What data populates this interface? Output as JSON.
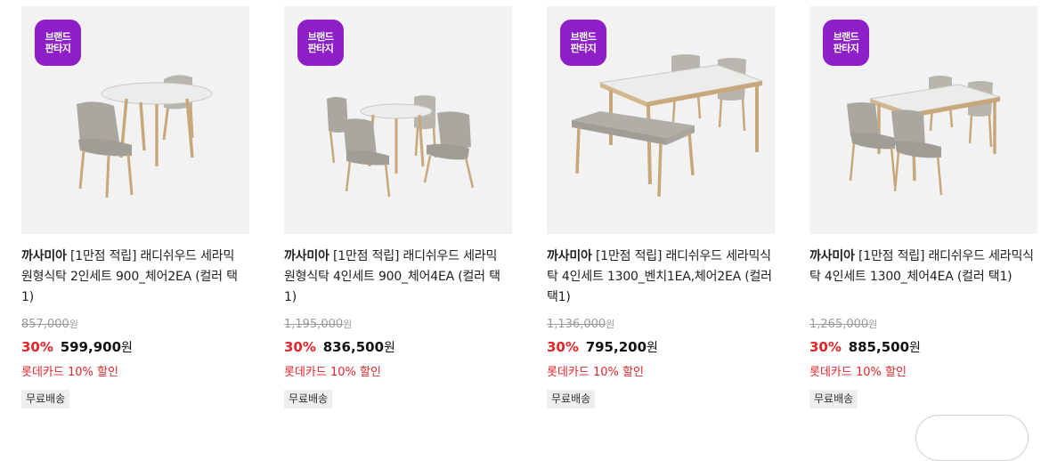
{
  "products": [
    {
      "badge_line1": "브랜드",
      "badge_line2": "판타지",
      "brand": "까사미아",
      "title": "[1만점 적립] 래디쉬우드 세라믹 원형식탁 2인세트 900_체어2EA (컬러 택1)",
      "original_price": "857,000",
      "original_unit": "원",
      "discount_rate": "30%",
      "sale_price": "599,900",
      "sale_unit": "원",
      "card_benefit": "롯데카드 10% 할인",
      "shipping_tag": "무료배송"
    },
    {
      "badge_line1": "브랜드",
      "badge_line2": "판타지",
      "brand": "까사미아",
      "title": "[1만점 적립] 래디쉬우드 세라믹 원형식탁 4인세트 900_체어4EA (컬러 택1)",
      "original_price": "1,195,000",
      "original_unit": "원",
      "discount_rate": "30%",
      "sale_price": "836,500",
      "sale_unit": "원",
      "card_benefit": "롯데카드 10% 할인",
      "shipping_tag": "무료배송"
    },
    {
      "badge_line1": "브랜드",
      "badge_line2": "판타지",
      "brand": "까사미아",
      "title": "[1만점 적립] 래디쉬우드 세라믹식탁 4인세트 1300_벤치1EA,체어2EA (컬러 택1)",
      "original_price": "1,136,000",
      "original_unit": "원",
      "discount_rate": "30%",
      "sale_price": "795,200",
      "sale_unit": "원",
      "card_benefit": "롯데카드 10% 할인",
      "shipping_tag": "무료배송"
    },
    {
      "badge_line1": "브랜드",
      "badge_line2": "판타지",
      "brand": "까사미아",
      "title": "[1만점 적립] 래디쉬우드 세라믹식탁 4인세트 1300_체어4EA (컬러 택1)",
      "original_price": "1,265,000",
      "original_unit": "원",
      "discount_rate": "30%",
      "sale_price": "885,500",
      "sale_unit": "원",
      "card_benefit": "롯데카드 10% 할인",
      "shipping_tag": "무료배송"
    }
  ],
  "colors": {
    "badge": "#8e1fc8",
    "discount": "#e52528",
    "thumb_bg": "#f2f2f2"
  },
  "icons": {
    "badge": "brand-fantasy-badge-icon",
    "product": "dining-set-image"
  }
}
